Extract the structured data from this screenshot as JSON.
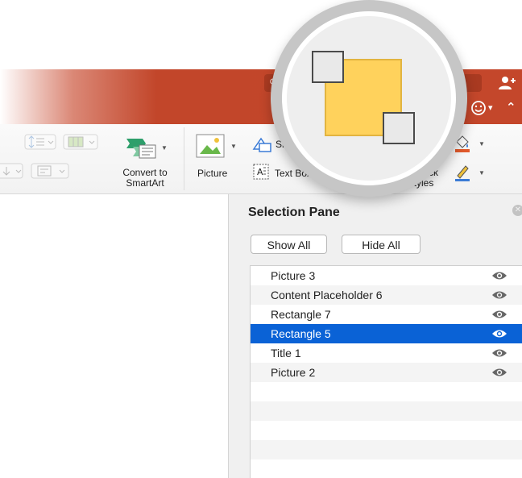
{
  "ribbon": {
    "convert_label_line1": "Convert to",
    "convert_label_line2": "SmartArt",
    "picture_label": "Picture",
    "shape_label": "Sha",
    "textbox_label": "Text Box",
    "quickstyles_line1": "ick",
    "quickstyles_line2": "Styles"
  },
  "selection_pane": {
    "title": "Selection Pane",
    "show_all": "Show All",
    "hide_all": "Hide All",
    "items": [
      {
        "label": "Picture 3",
        "selected": false
      },
      {
        "label": "Content Placeholder 6",
        "selected": false
      },
      {
        "label": "Rectangle 7",
        "selected": false
      },
      {
        "label": "Rectangle 5",
        "selected": true
      },
      {
        "label": "Title 1",
        "selected": false
      },
      {
        "label": "Picture 2",
        "selected": false
      }
    ]
  },
  "icons": {
    "search": "search-icon",
    "share": "add-person-icon",
    "feedback": "smiley-icon",
    "collapse": "chevron-up-icon",
    "visibility": "eye-icon",
    "arrange": "arrange-shapes-icon"
  },
  "colors": {
    "title_bar": "#c4472b",
    "selection": "#0a62d6",
    "shape_fill": "#ffd25c"
  }
}
